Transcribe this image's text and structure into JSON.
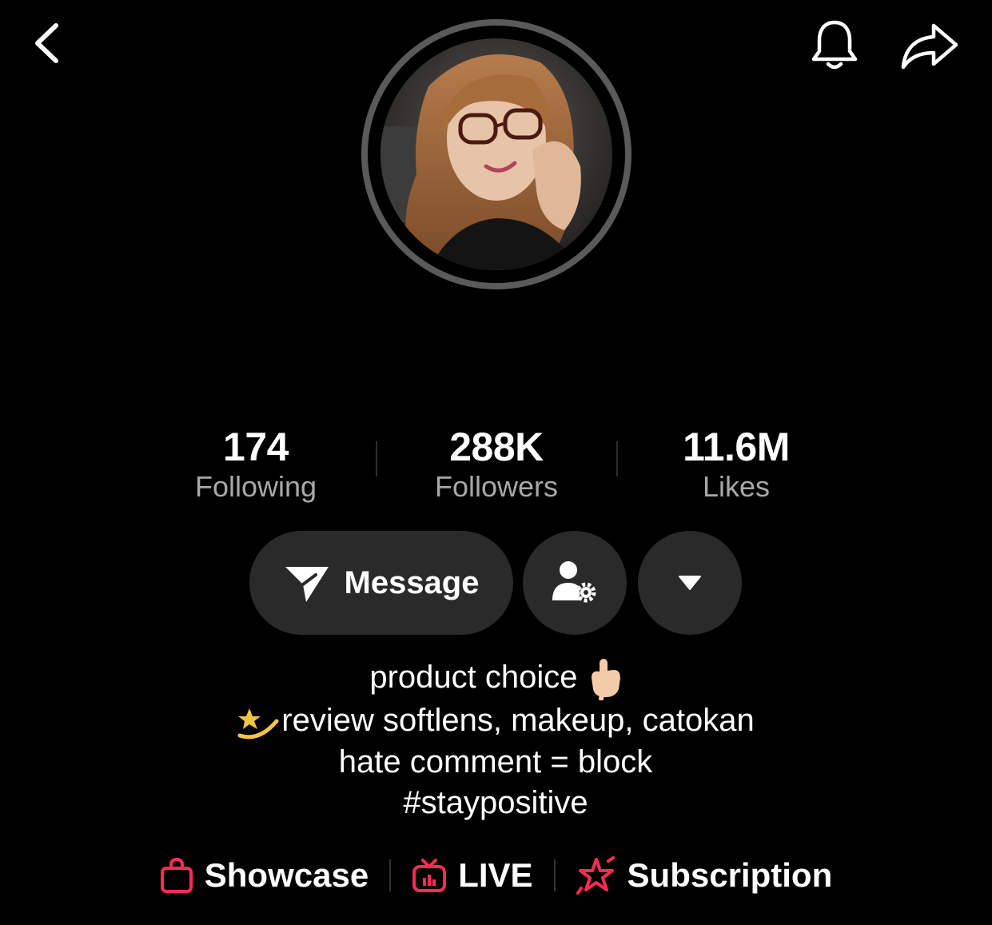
{
  "header": {
    "back_icon": "chevron-left-icon",
    "bell_icon": "bell-icon",
    "share_icon": "share-arrow-icon"
  },
  "profile": {
    "avatar": "profile-photo"
  },
  "stats": [
    {
      "value": "174",
      "label": "Following"
    },
    {
      "value": "288K",
      "label": "Followers"
    },
    {
      "value": "11.6M",
      "label": "Likes"
    }
  ],
  "actions": {
    "message_label": "Message",
    "message_icon": "paper-plane-icon",
    "friend_settings_icon": "user-gear-icon",
    "more_icon": "caret-down-icon"
  },
  "bio": {
    "line1": "product choice",
    "line2": "review softlens, makeup, catokan",
    "line3": "hate comment = block",
    "line4": "#staypositive"
  },
  "links": {
    "showcase": "Showcase",
    "live": "LIVE",
    "subscription": "Subscription"
  },
  "colors": {
    "background": "#000000",
    "button": "#2a2a2a",
    "accent": "#fe2c55",
    "muted_text": "#a8a8a8"
  }
}
